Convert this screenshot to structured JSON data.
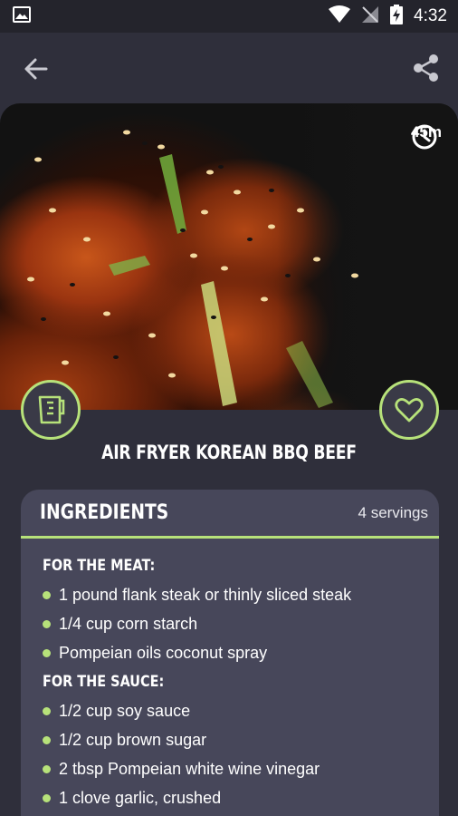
{
  "status_bar": {
    "time": "4:32",
    "icons": [
      "image-icon",
      "wifi-icon",
      "no-signal-icon",
      "battery-charging-icon"
    ]
  },
  "app_bar": {
    "back_icon": "arrow-left-icon",
    "share_icon": "share-icon"
  },
  "hero": {
    "cook_time": "45m",
    "clock_icon": "clock-icon"
  },
  "actions": {
    "measure_icon": "measuring-cup-icon",
    "favorite_icon": "heart-outline-icon"
  },
  "recipe": {
    "title": "AIR FRYER KOREAN BBQ BEEF"
  },
  "ingredients": {
    "heading": "INGREDIENTS",
    "servings": "4 servings",
    "sections": [
      {
        "title": "FOR THE MEAT:",
        "items": [
          "1 pound flank steak or thinly sliced steak",
          "1/4 cup corn starch",
          "Pompeian oils coconut spray"
        ]
      },
      {
        "title": "FOR THE SAUCE:",
        "items": [
          "1/2 cup soy sauce",
          "1/2 cup brown sugar",
          "2 tbsp Pompeian white wine vinegar",
          "1 clove garlic, crushed"
        ]
      }
    ]
  },
  "colors": {
    "accent": "#b7e27a",
    "background": "#2f2f3b",
    "card": "#47475a",
    "status_bar": "#24242c"
  }
}
